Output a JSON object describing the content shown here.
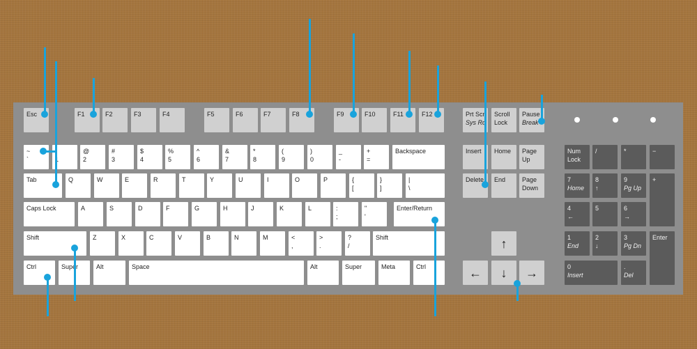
{
  "keyboard": {
    "function_row": {
      "esc": "Esc",
      "f1": "F1",
      "f2": "F2",
      "f3": "F3",
      "f4": "F4",
      "f5": "F5",
      "f6": "F6",
      "f7": "F7",
      "f8": "F8",
      "f9": "F9",
      "f10": "F10",
      "f11": "F11",
      "f12": "F12",
      "prtscn": [
        "Prt Scn",
        "Sys Rq"
      ],
      "scroll": [
        "Scroll",
        "Lock"
      ],
      "pause": [
        "Pause",
        "Break"
      ]
    },
    "number_row": {
      "tilde": [
        "~",
        "`"
      ],
      "k1": [
        "!",
        "1"
      ],
      "k2": [
        "@",
        "2"
      ],
      "k3": [
        "#",
        "3"
      ],
      "k4": [
        "$",
        "4"
      ],
      "k5": [
        "%",
        "5"
      ],
      "k6": [
        "^",
        "6"
      ],
      "k7": [
        "&",
        "7"
      ],
      "k8": [
        "*",
        "8"
      ],
      "k9": [
        "(",
        "9"
      ],
      "k0": [
        ")",
        "0"
      ],
      "minus": [
        "_",
        "-"
      ],
      "equals": [
        "+",
        "="
      ],
      "backspace": "Backspace"
    },
    "qwerty_row": {
      "tab": "Tab",
      "q": "Q",
      "w": "W",
      "e": "E",
      "r": "R",
      "t": "T",
      "y": "Y",
      "u": "U",
      "i": "I",
      "o": "O",
      "p": "P",
      "lbracket": [
        "{",
        "["
      ],
      "rbracket": [
        "}",
        "]"
      ],
      "backslash": [
        "|",
        "\\"
      ]
    },
    "home_row": {
      "caps": "Caps Lock",
      "a": "A",
      "s": "S",
      "d": "D",
      "f": "F",
      "g": "G",
      "h": "H",
      "j": "J",
      "k": "K",
      "l": "L",
      "semicolon": [
        ":",
        ";"
      ],
      "quote": [
        "\"",
        "'"
      ],
      "enter": "Enter/Return"
    },
    "shift_row": {
      "lshift": "Shift",
      "z": "Z",
      "x": "X",
      "c": "C",
      "v": "V",
      "b": "B",
      "n": "N",
      "m": "M",
      "comma": [
        "<",
        ","
      ],
      "period": [
        ">",
        "."
      ],
      "slash": [
        "?",
        "/"
      ],
      "rshift": "Shift"
    },
    "bottom_row": {
      "lctrl": "Ctrl",
      "lsuper": "Super",
      "lalt": "Alt",
      "space": "Space",
      "ralt": "Alt",
      "rsuper": "Super",
      "meta": "Meta",
      "rctrl": "Ctrl"
    },
    "nav_cluster": {
      "insert": "Insert",
      "home": "Home",
      "pgup": [
        "Page",
        "Up"
      ],
      "delete": "Delete",
      "end": "End",
      "pgdn": [
        "Page",
        "Down"
      ],
      "up": "↑",
      "left": "←",
      "down": "↓",
      "right": "→"
    },
    "numpad": {
      "numlock": [
        "Num",
        "Lock"
      ],
      "div": "/",
      "mul": "*",
      "sub": "−",
      "n7": [
        "7",
        "Home"
      ],
      "n8": [
        "8",
        "↑"
      ],
      "n9": [
        "9",
        "Pg Up"
      ],
      "add": "+",
      "n4": [
        "4",
        "←"
      ],
      "n5": "5",
      "n6": [
        "6",
        "→"
      ],
      "n1": [
        "1",
        "End"
      ],
      "n2": [
        "2",
        "↓"
      ],
      "n3": [
        "3",
        "Pg Dn"
      ],
      "enter": "Enter",
      "n0": [
        "0",
        "Insert"
      ],
      "dot": [
        ".",
        "Del"
      ]
    }
  },
  "colors": {
    "background": "#a5763f",
    "keyboard_body": "#8e8e8e",
    "main_keys": "#ffffff",
    "function_keys": "#d0d0d0",
    "numpad_keys": "#5b5b5b",
    "pointer_lines": "#19a3dc"
  }
}
